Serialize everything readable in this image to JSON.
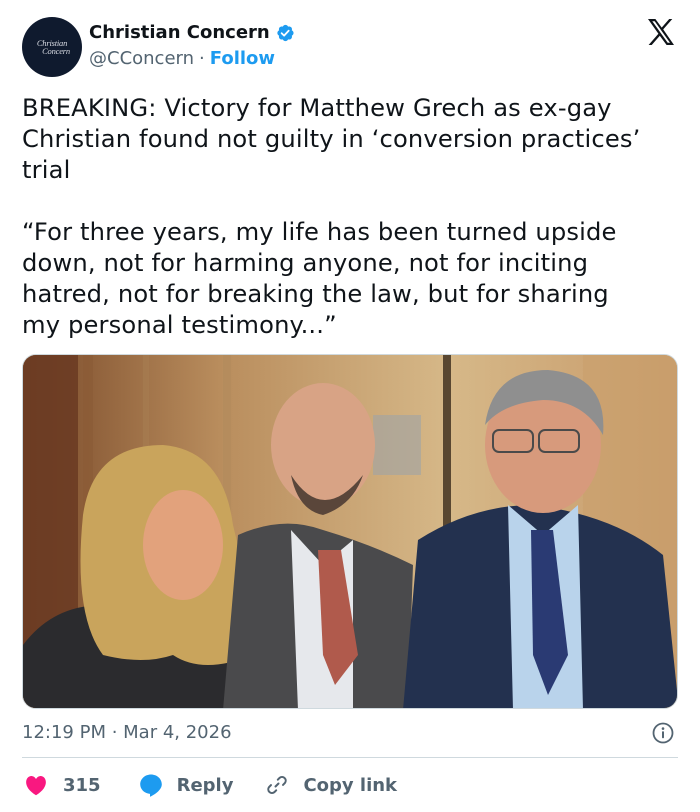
{
  "account": {
    "display_name": "Christian Concern",
    "handle": "@CConcern",
    "separator": "·",
    "follow_label": "Follow",
    "avatar_text_line1": "Christian",
    "avatar_text_line2": "Concern",
    "verified": true
  },
  "tweet": {
    "text": "BREAKING: Victory for Matthew Grech as ex-gay\nChristian found not guilty in ‘conversion practices’\ntrial\n\n“For three years, my life has been turned upside\ndown, not for harming anyone, not for inciting\nhatred, not for breaking the law, but for sharing\nmy personal testimony...”",
    "image_content": "three-people-smiling-photo"
  },
  "meta": {
    "time": "12:19 PM",
    "separator": "·",
    "date": "Mar 4, 2026",
    "timestamp_display": "12:19 PM · Mar 4, 2026"
  },
  "actions": {
    "like_count": "315",
    "reply_label": "Reply",
    "copy_link_label": "Copy link"
  },
  "colors": {
    "like": "#f91880",
    "reply": "#1d9bf0",
    "link": "#1d9bf0",
    "verified": "#1d9bf0",
    "muted_text": "#536471",
    "text": "#0f1419"
  },
  "icons": [
    "x-logo-icon",
    "verified-badge-icon",
    "info-icon",
    "heart-icon",
    "reply-bubble-icon",
    "link-icon"
  ]
}
